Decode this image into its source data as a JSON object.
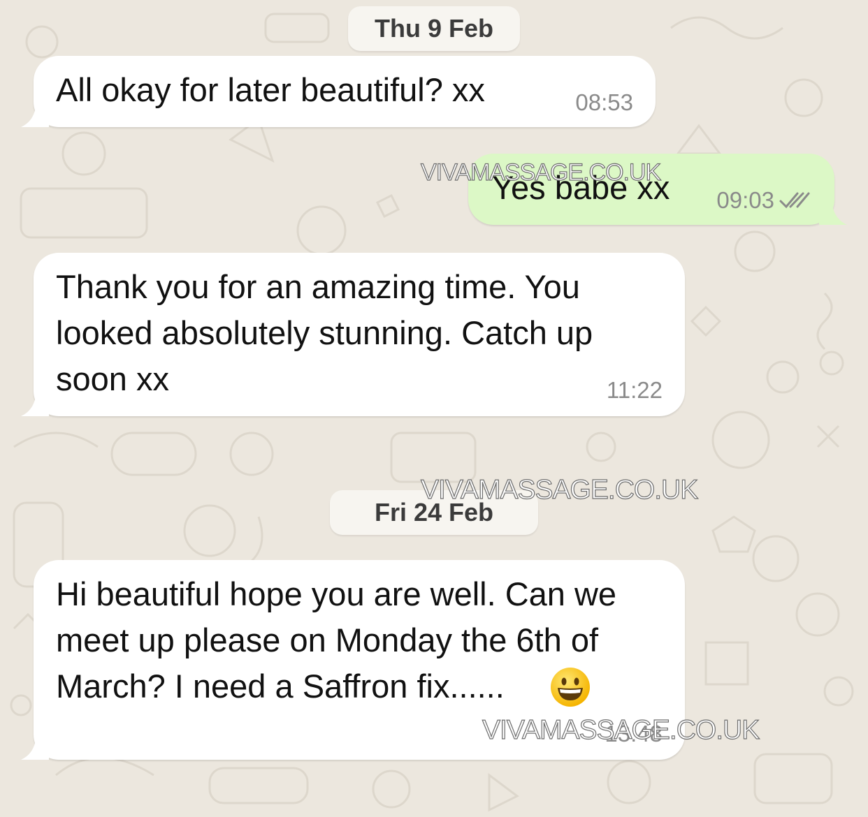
{
  "chat": {
    "date_1": "Thu 9 Feb",
    "date_2": "Fri 24 Feb",
    "messages": [
      {
        "text": "All okay for later beautiful? xx",
        "time": "08:53",
        "direction": "incoming"
      },
      {
        "text": "Yes babe xx",
        "time": "09:03",
        "direction": "outgoing",
        "status": "read"
      },
      {
        "text": "Thank you for an amazing time. You looked absolutely stunning. Catch up soon xx",
        "time": "11:22",
        "direction": "incoming"
      },
      {
        "text": "Hi beautiful hope you are well. Can we meet up please on Monday the 6th of March? I need a Saffron fix......",
        "time": "13:48",
        "direction": "incoming",
        "emoji": "grinning-face"
      }
    ]
  },
  "watermark": "VIVAMASSAGE.CO.UK",
  "colors": {
    "background": "#ece7de",
    "incoming_bubble": "#ffffff",
    "outgoing_bubble": "#dcf8c6",
    "timestamp": "#8a8a8a",
    "read_ticks": "#8a8a8a"
  }
}
